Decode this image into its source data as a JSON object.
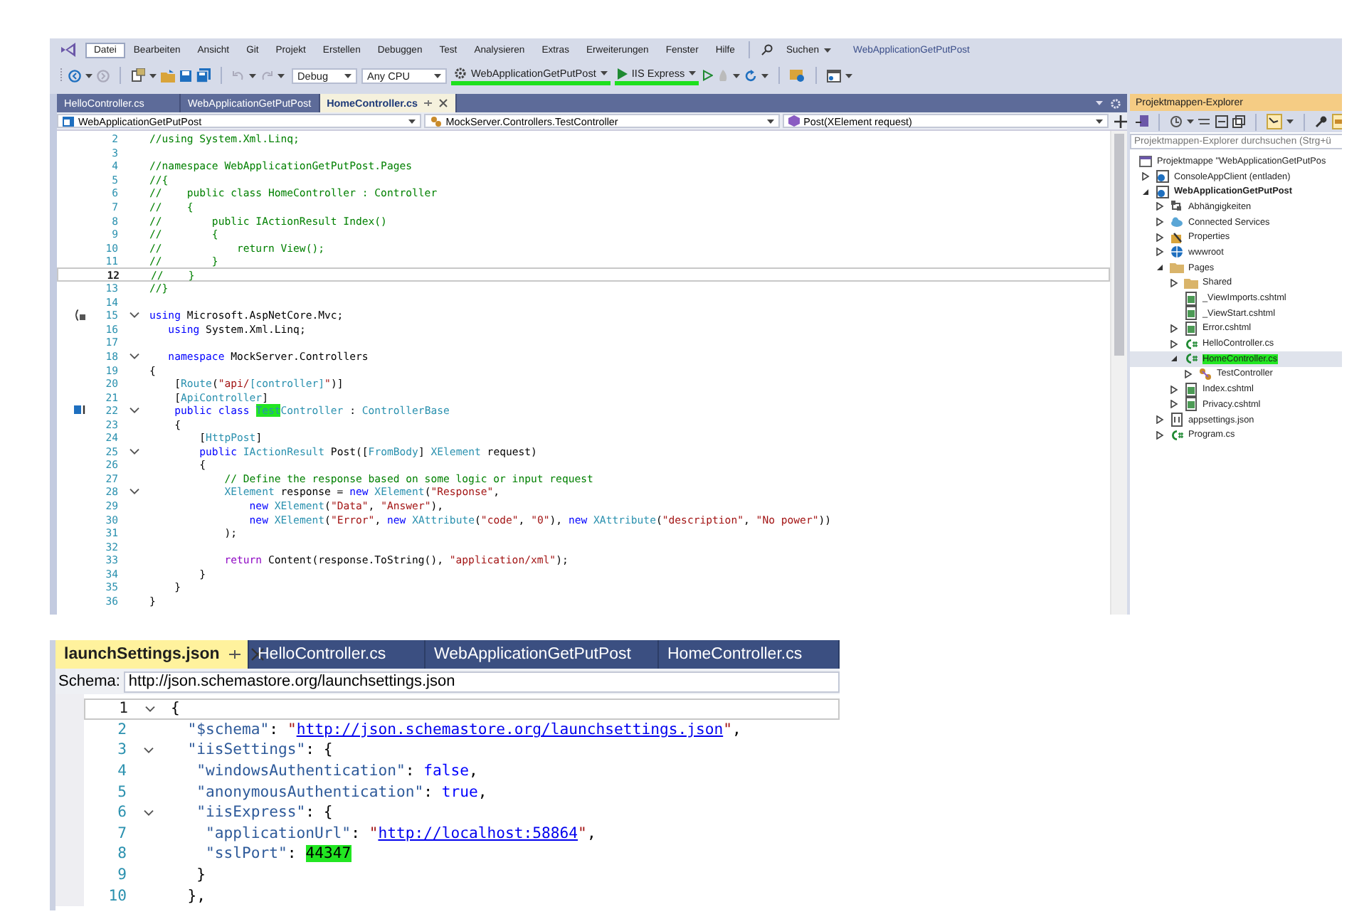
{
  "top_window": {
    "menu": [
      {
        "label": "Datei",
        "selected": true
      },
      {
        "label": "Bearbeiten",
        "selected": false
      },
      {
        "label": "Ansicht",
        "selected": false
      },
      {
        "label": "Git",
        "selected": false
      },
      {
        "label": "Projekt",
        "selected": false
      },
      {
        "label": "Erstellen",
        "selected": false
      },
      {
        "label": "Debuggen",
        "selected": false
      },
      {
        "label": "Test",
        "selected": false
      },
      {
        "label": "Analysieren",
        "selected": false
      },
      {
        "label": "Extras",
        "selected": false
      },
      {
        "label": "Erweiterungen",
        "selected": false
      },
      {
        "label": "Fenster",
        "selected": false
      },
      {
        "label": "Hilfe",
        "selected": false
      }
    ],
    "search": "Suchen",
    "title": "WebApplicationGetPutPost",
    "toolbar": {
      "configuration": "Debug",
      "platform": "Any CPU",
      "startup_project": {
        "label": "WebApplicationGetPutPost",
        "highlight": true
      },
      "run": {
        "label": "IIS Express",
        "highlight": true
      }
    },
    "editor": {
      "tabs": [
        {
          "label": "HelloController.cs",
          "selected": false
        },
        {
          "label": "WebApplicationGetPutPost",
          "selected": false
        },
        {
          "label": "HomeController.cs",
          "selected": true
        }
      ],
      "nav": [
        "WebApplicationGetPutPost",
        "MockServer.Controllers.TestController",
        "Post(XElement request)"
      ],
      "lines": [
        {
          "number": "2",
          "current": false,
          "foldable": false,
          "tokens": [
            {
              "kind": "comment",
              "text": "//using System.Xml.Linq;"
            }
          ]
        },
        {
          "number": "3",
          "current": false,
          "foldable": false
        },
        {
          "number": "4",
          "current": false,
          "foldable": false,
          "tokens": [
            {
              "kind": "comment",
              "text": "//namespace WebApplicationGetPutPost.Pages"
            }
          ]
        },
        {
          "number": "5",
          "current": false,
          "foldable": false,
          "tokens": [
            {
              "kind": "comment",
              "text": "//{"
            }
          ]
        },
        {
          "number": "6",
          "current": false,
          "foldable": false,
          "tokens": [
            {
              "kind": "comment",
              "text": "//    public class HomeController : Controller"
            }
          ]
        },
        {
          "number": "7",
          "current": false,
          "foldable": false,
          "tokens": [
            {
              "kind": "comment",
              "text": "//    {"
            }
          ]
        },
        {
          "number": "8",
          "current": false,
          "foldable": false,
          "tokens": [
            {
              "kind": "comment",
              "text": "//        public IActionResult Index()"
            }
          ]
        },
        {
          "number": "9",
          "current": false,
          "foldable": false,
          "tokens": [
            {
              "kind": "comment",
              "text": "//        {"
            }
          ]
        },
        {
          "number": "10",
          "current": false,
          "foldable": false,
          "tokens": [
            {
              "kind": "comment",
              "text": "//            return View();"
            }
          ]
        },
        {
          "number": "11",
          "current": false,
          "foldable": false,
          "tokens": [
            {
              "kind": "comment",
              "text": "//        }"
            }
          ]
        },
        {
          "number": "12",
          "current": true,
          "foldable": false,
          "tokens": [
            {
              "kind": "comment",
              "text": "//    }"
            }
          ]
        },
        {
          "number": "13",
          "current": false,
          "foldable": false,
          "tokens": [
            {
              "kind": "comment",
              "text": "//}"
            }
          ]
        },
        {
          "number": "14",
          "current": false,
          "foldable": false
        },
        {
          "number": "15",
          "current": false,
          "foldable": true,
          "kind": "usings",
          "tokens": [
            {
              "kind": "keyword",
              "text": "using"
            },
            {
              "kind": "plain",
              "text": " Microsoft.AspNetCore.Mvc;"
            }
          ]
        },
        {
          "number": "16",
          "current": false,
          "foldable": false,
          "tokens": [
            {
              "kind": "keyword",
              "text": "   using"
            },
            {
              "kind": "plain",
              "text": " System.Xml.Linq;"
            }
          ]
        },
        {
          "number": "17",
          "current": false,
          "foldable": false
        },
        {
          "number": "18",
          "current": false,
          "foldable": true,
          "tokens": [
            {
              "kind": "keyword",
              "text": "   namespace"
            },
            {
              "kind": "plain",
              "text": " MockServer.Controllers"
            }
          ]
        },
        {
          "number": "19",
          "current": false,
          "foldable": false,
          "tokens": [
            {
              "kind": "plain",
              "text": "{"
            }
          ]
        },
        {
          "number": "20",
          "current": false,
          "foldable": false,
          "tokens": [
            {
              "kind": "plain",
              "text": "    ["
            },
            {
              "kind": "type",
              "text": "Route"
            },
            {
              "kind": "plain",
              "text": "("
            },
            {
              "kind": "string",
              "text": "\"api/"
            },
            {
              "kind": "type",
              "text": "[controller]"
            },
            {
              "kind": "string",
              "text": "\""
            },
            {
              "kind": "plain",
              "text": ")]"
            }
          ]
        },
        {
          "number": "21",
          "current": false,
          "foldable": false,
          "tokens": [
            {
              "kind": "plain",
              "text": "    ["
            },
            {
              "kind": "type",
              "text": "ApiController"
            },
            {
              "kind": "plain",
              "text": "]"
            }
          ]
        },
        {
          "number": "22",
          "current": false,
          "foldable": true,
          "kind": "class",
          "tokens": [
            {
              "kind": "keyword",
              "text": "    public class "
            },
            {
              "kind": "type",
              "text": "Test",
              "highlight": true
            },
            {
              "kind": "type",
              "text": "Controller"
            },
            {
              "kind": "plain",
              "text": " : "
            },
            {
              "kind": "type",
              "text": "ControllerBase"
            }
          ]
        },
        {
          "number": "23",
          "current": false,
          "foldable": false,
          "tokens": [
            {
              "kind": "plain",
              "text": "    {"
            }
          ]
        },
        {
          "number": "24",
          "current": false,
          "foldable": false,
          "tokens": [
            {
              "kind": "plain",
              "text": "        ["
            },
            {
              "kind": "type",
              "text": "HttpPost"
            },
            {
              "kind": "plain",
              "text": "]"
            }
          ]
        },
        {
          "number": "25",
          "current": false,
          "foldable": true,
          "tokens": [
            {
              "kind": "keyword",
              "text": "        public "
            },
            {
              "kind": "type",
              "text": "IActionResult"
            },
            {
              "kind": "plain",
              "text": " Post(["
            },
            {
              "kind": "type",
              "text": "FromBody"
            },
            {
              "kind": "plain",
              "text": "] "
            },
            {
              "kind": "type",
              "text": "XElement"
            },
            {
              "kind": "plain",
              "text": " request)"
            }
          ]
        },
        {
          "number": "26",
          "current": false,
          "foldable": false,
          "tokens": [
            {
              "kind": "plain",
              "text": "        {"
            }
          ]
        },
        {
          "number": "27",
          "current": false,
          "foldable": false,
          "tokens": [
            {
              "kind": "comment",
              "text": "            // Define the response based on some logic or input request"
            }
          ]
        },
        {
          "number": "28",
          "current": false,
          "foldable": true,
          "tokens": [
            {
              "kind": "type",
              "text": "            XElement"
            },
            {
              "kind": "plain",
              "text": " response = "
            },
            {
              "kind": "keyword",
              "text": "new "
            },
            {
              "kind": "type",
              "text": "XElement"
            },
            {
              "kind": "plain",
              "text": "("
            },
            {
              "kind": "string",
              "text": "\"Response\""
            },
            {
              "kind": "plain",
              "text": ","
            }
          ]
        },
        {
          "number": "29",
          "current": false,
          "foldable": false,
          "tokens": [
            {
              "kind": "keyword",
              "text": "                new "
            },
            {
              "kind": "type",
              "text": "XElement"
            },
            {
              "kind": "plain",
              "text": "("
            },
            {
              "kind": "string",
              "text": "\"Data\""
            },
            {
              "kind": "plain",
              "text": ", "
            },
            {
              "kind": "string",
              "text": "\"Answer\""
            },
            {
              "kind": "plain",
              "text": "),"
            }
          ]
        },
        {
          "number": "30",
          "current": false,
          "foldable": false,
          "tokens": [
            {
              "kind": "keyword",
              "text": "                new "
            },
            {
              "kind": "type",
              "text": "XElement"
            },
            {
              "kind": "plain",
              "text": "("
            },
            {
              "kind": "string",
              "text": "\"Error\""
            },
            {
              "kind": "plain",
              "text": ", "
            },
            {
              "kind": "keyword",
              "text": "new "
            },
            {
              "kind": "type",
              "text": "XAttribute"
            },
            {
              "kind": "plain",
              "text": "("
            },
            {
              "kind": "string",
              "text": "\"code\""
            },
            {
              "kind": "plain",
              "text": ", "
            },
            {
              "kind": "string",
              "text": "\"0\""
            },
            {
              "kind": "plain",
              "text": "), "
            },
            {
              "kind": "keyword",
              "text": "new "
            },
            {
              "kind": "type",
              "text": "XAttribute"
            },
            {
              "kind": "plain",
              "text": "("
            },
            {
              "kind": "string",
              "text": "\"description\""
            },
            {
              "kind": "plain",
              "text": ", "
            },
            {
              "kind": "string",
              "text": "\"No power\""
            },
            {
              "kind": "plain",
              "text": "))"
            }
          ]
        },
        {
          "number": "31",
          "current": false,
          "foldable": false,
          "tokens": [
            {
              "kind": "plain",
              "text": "            );"
            }
          ]
        },
        {
          "number": "32",
          "current": false,
          "foldable": false
        },
        {
          "number": "33",
          "current": false,
          "foldable": false,
          "tokens": [
            {
              "kind": "control",
              "text": "            return"
            },
            {
              "kind": "plain",
              "text": " Content(response.ToString(), "
            },
            {
              "kind": "string",
              "text": "\"application/xml\""
            },
            {
              "kind": "plain",
              "text": ");"
            }
          ]
        },
        {
          "number": "34",
          "current": false,
          "foldable": false,
          "tokens": [
            {
              "kind": "plain",
              "text": "        }"
            }
          ]
        },
        {
          "number": "35",
          "current": false,
          "foldable": false,
          "tokens": [
            {
              "kind": "plain",
              "text": "    }"
            }
          ]
        },
        {
          "number": "36",
          "current": false,
          "foldable": false,
          "tokens": [
            {
              "kind": "plain",
              "text": "}"
            }
          ]
        }
      ]
    },
    "explorer": {
      "title": "Projektmappen-Explorer",
      "search_placeholder": "Projektmappen-Explorer durchsuchen (Strg+ü",
      "tree": [
        {
          "label": "Projektmappe \"WebApplicationGetPutPos",
          "kind": "solution",
          "selected": false,
          "children": [
            {
              "label": "ConsoleAppClient (entladen)",
              "kind": "project",
              "expanded": false,
              "selected": false
            },
            {
              "label": "WebApplicationGetPutPost",
              "kind": "project",
              "startup": true,
              "expanded": true,
              "selected": false,
              "children": [
                {
                  "label": "Abhängigkeiten",
                  "kind": "deps",
                  "expanded": false,
                  "selected": false
                },
                {
                  "label": "Connected Services",
                  "kind": "service",
                  "expanded": false,
                  "selected": false
                },
                {
                  "label": "Properties",
                  "kind": "properties",
                  "expanded": false,
                  "selected": false
                },
                {
                  "label": "wwwroot",
                  "kind": "globe",
                  "expanded": false,
                  "selected": false
                },
                {
                  "label": "Pages",
                  "kind": "folder",
                  "expanded": true,
                  "selected": false,
                  "children": [
                    {
                      "label": "Shared",
                      "kind": "folder",
                      "expanded": false,
                      "selected": false
                    },
                    {
                      "label": "_ViewImports.cshtml",
                      "kind": "cshtml",
                      "selected": false
                    },
                    {
                      "label": "_ViewStart.cshtml",
                      "kind": "cshtml",
                      "selected": false
                    },
                    {
                      "label": "Error.cshtml",
                      "kind": "cshtml",
                      "expanded": false,
                      "selected": false
                    },
                    {
                      "label": "HelloController.cs",
                      "kind": "cs",
                      "expanded": false,
                      "selected": false
                    },
                    {
                      "label": "HomeController.cs",
                      "kind": "cs",
                      "expanded": true,
                      "selected": true,
                      "highlight": true,
                      "children": [
                        {
                          "label": "TestController",
                          "kind": "class",
                          "expanded": false,
                          "selected": false
                        }
                      ]
                    },
                    {
                      "label": "Index.cshtml",
                      "kind": "cshtml",
                      "expanded": false,
                      "selected": false
                    },
                    {
                      "label": "Privacy.cshtml",
                      "kind": "cshtml",
                      "expanded": false,
                      "selected": false
                    }
                  ]
                },
                {
                  "label": "appsettings.json",
                  "kind": "json",
                  "expanded": false,
                  "selected": false
                },
                {
                  "label": "Program.cs",
                  "kind": "cs",
                  "expanded": false,
                  "selected": false
                }
              ]
            }
          ]
        }
      ]
    }
  },
  "bottom_window": {
    "tabs": [
      {
        "label": "launchSettings.json",
        "selected": true
      },
      {
        "label": "HelloController.cs",
        "selected": false
      },
      {
        "label": "WebApplicationGetPutPost",
        "selected": false
      },
      {
        "label": "HomeController.cs",
        "selected": false
      }
    ],
    "schema_label": "Schema:",
    "schema_url": "http://json.schemastore.org/launchsettings.json",
    "lines": [
      {
        "number": "1",
        "current": true,
        "foldable": true,
        "tokens": [
          {
            "kind": "plain",
            "text": "{"
          }
        ]
      },
      {
        "number": "2",
        "current": false,
        "foldable": false,
        "tokens": [
          {
            "kind": "key",
            "text": "  \"$schema\""
          },
          {
            "kind": "plain",
            "text": ": "
          },
          {
            "kind": "string",
            "text": "\""
          },
          {
            "kind": "link",
            "text": "http://json.schemastore.org/launchsettings.json"
          },
          {
            "kind": "string",
            "text": "\""
          },
          {
            "kind": "plain",
            "text": ","
          }
        ]
      },
      {
        "number": "3",
        "current": false,
        "foldable": true,
        "tokens": [
          {
            "kind": "key",
            "text": "  \"iisSettings\""
          },
          {
            "kind": "plain",
            "text": ": {"
          }
        ]
      },
      {
        "number": "4",
        "current": false,
        "foldable": false,
        "tokens": [
          {
            "kind": "key",
            "text": "   \"windowsAuthentication\""
          },
          {
            "kind": "plain",
            "text": ": "
          },
          {
            "kind": "keyword",
            "text": "false"
          },
          {
            "kind": "plain",
            "text": ","
          }
        ]
      },
      {
        "number": "5",
        "current": false,
        "foldable": false,
        "tokens": [
          {
            "kind": "key",
            "text": "   \"anonymousAuthentication\""
          },
          {
            "kind": "plain",
            "text": ": "
          },
          {
            "kind": "keyword",
            "text": "true"
          },
          {
            "kind": "plain",
            "text": ","
          }
        ]
      },
      {
        "number": "6",
        "current": false,
        "foldable": true,
        "tokens": [
          {
            "kind": "key",
            "text": "   \"iisExpress\""
          },
          {
            "kind": "plain",
            "text": ": {"
          }
        ]
      },
      {
        "number": "7",
        "current": false,
        "foldable": false,
        "tokens": [
          {
            "kind": "key",
            "text": "    \"applicationUrl\""
          },
          {
            "kind": "plain",
            "text": ": "
          },
          {
            "kind": "string",
            "text": "\""
          },
          {
            "kind": "link",
            "text": "http://localhost:58864"
          },
          {
            "kind": "string",
            "text": "\""
          },
          {
            "kind": "plain",
            "text": ","
          }
        ]
      },
      {
        "number": "8",
        "current": false,
        "foldable": false,
        "tokens": [
          {
            "kind": "key",
            "text": "    \"sslPort\""
          },
          {
            "kind": "plain",
            "text": ": "
          },
          {
            "kind": "number",
            "text": "44347",
            "highlight": true
          }
        ]
      },
      {
        "number": "9",
        "current": false,
        "foldable": false,
        "tokens": [
          {
            "kind": "plain",
            "text": "   }"
          }
        ]
      },
      {
        "number": "10",
        "current": false,
        "foldable": false,
        "tokens": [
          {
            "kind": "plain",
            "text": "  },"
          }
        ]
      }
    ]
  }
}
